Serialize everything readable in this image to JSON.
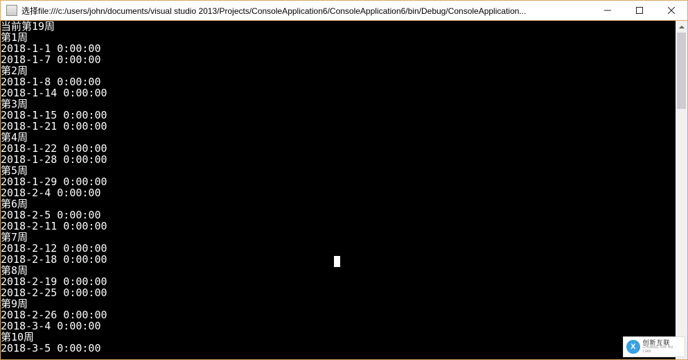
{
  "window": {
    "title": "选择file:///c:/users/john/documents/visual studio 2013/Projects/ConsoleApplication6/ConsoleApplication6/bin/Debug/ConsoleApplication..."
  },
  "console_lines": [
    "当前第19周",
    "第1周",
    "2018-1-1 0:00:00",
    "2018-1-7 0:00:00",
    "第2周",
    "2018-1-8 0:00:00",
    "2018-1-14 0:00:00",
    "第3周",
    "2018-1-15 0:00:00",
    "2018-1-21 0:00:00",
    "第4周",
    "2018-1-22 0:00:00",
    "2018-1-28 0:00:00",
    "第5周",
    "2018-1-29 0:00:00",
    "2018-2-4 0:00:00",
    "第6周",
    "2018-2-5 0:00:00",
    "2018-2-11 0:00:00",
    "第7周",
    "2018-2-12 0:00:00",
    "2018-2-18 0:00:00",
    "第8周",
    "2018-2-19 0:00:00",
    "2018-2-25 0:00:00",
    "第9周",
    "2018-2-26 0:00:00",
    "2018-3-4 0:00:00",
    "第10周",
    "2018-3-5 0:00:00"
  ],
  "watermark": {
    "logo_text": "X",
    "cn": "创新互联",
    "en": "CHUANG XIN HU LIAN"
  }
}
